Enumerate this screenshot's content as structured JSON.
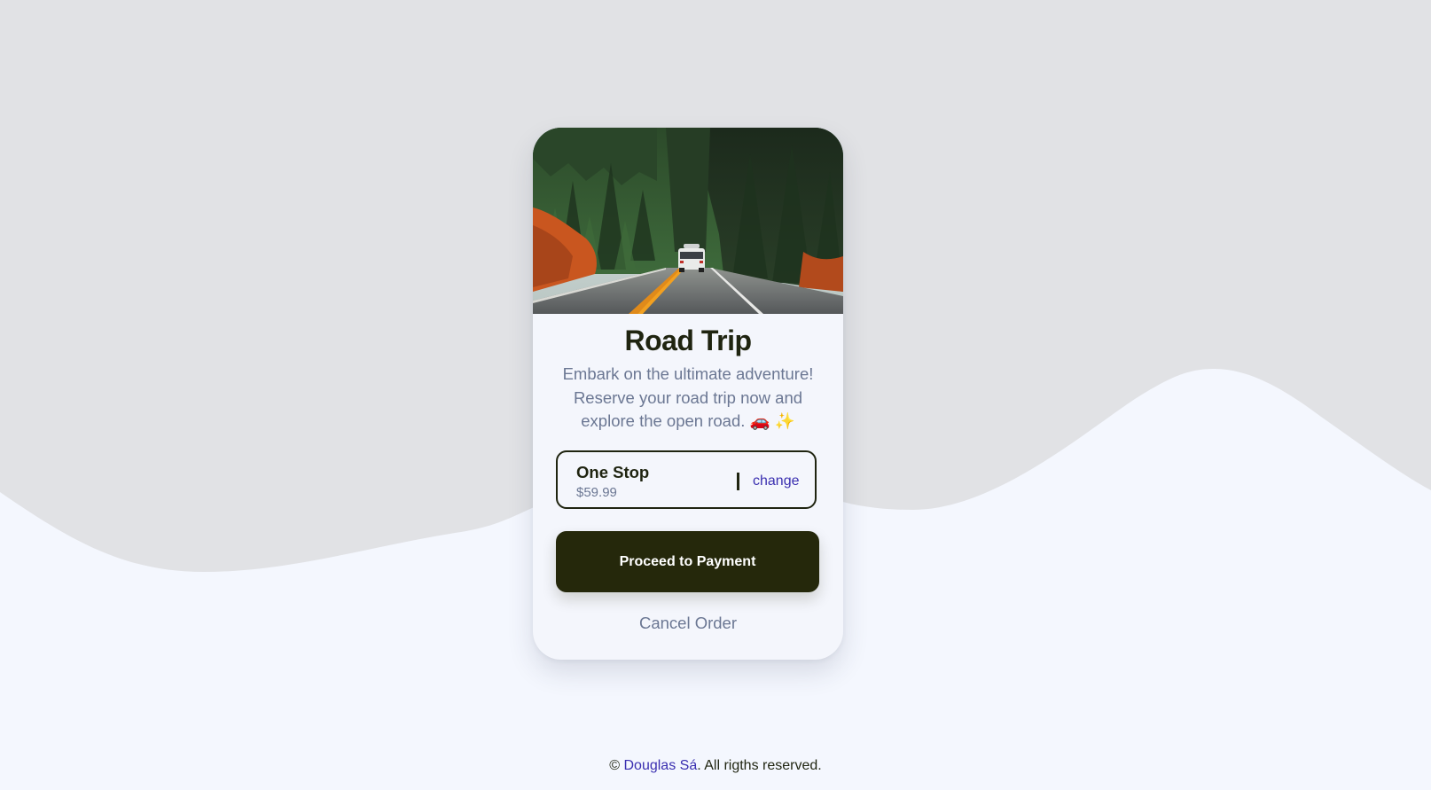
{
  "colors": {
    "background_top": "#e1e2e5",
    "background_wave": "#f4f7fe",
    "card": "#f4f6fc",
    "primary_dark": "#25280b",
    "muted_text": "#6b7793",
    "link": "#3a2fb0"
  },
  "card": {
    "image_icon": "road-trip-photo",
    "title": "Road Trip",
    "description": "Embark on the ultimate adventure! Reserve your road trip now and explore the open road. 🚗 ✨",
    "plan": {
      "name": "One Stop",
      "price": "$59.99",
      "change_label": "change"
    },
    "pay_label": "Proceed to Payment",
    "cancel_label": "Cancel Order"
  },
  "footer": {
    "prefix": "© ",
    "author": "Douglas Sá",
    "suffix": ". All rigths reserved."
  }
}
